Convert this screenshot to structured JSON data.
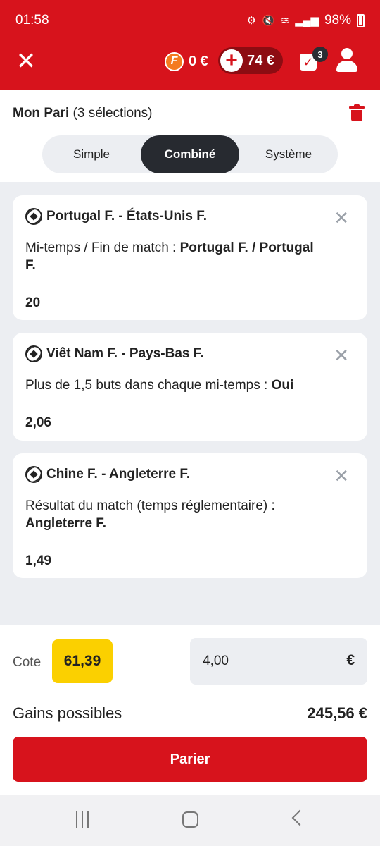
{
  "status_bar": {
    "time": "01:58",
    "battery": "98%"
  },
  "header": {
    "freebet_amount": "0 €",
    "balance": "74 €",
    "betslip_count": "3"
  },
  "bet": {
    "title_bold": "Mon Pari",
    "title_count": "(3 sélections)",
    "tabs": [
      {
        "label": "Simple"
      },
      {
        "label": "Combiné",
        "active": true
      },
      {
        "label": "Système"
      }
    ]
  },
  "selections": [
    {
      "match": "Portugal F. - États-Unis F.",
      "market": "Mi-temps / Fin de match : ",
      "pick": "Portugal F. / Portugal F.",
      "odds": "20"
    },
    {
      "match": "Viêt Nam F. - Pays-Bas F.",
      "market": "Plus de 1,5 buts dans chaque mi-temps : ",
      "pick": "Oui",
      "odds": "2,06"
    },
    {
      "match": "Chine F. - Angleterre F.",
      "market": "Résultat du match (temps réglementaire) : ",
      "pick": "Angleterre F.",
      "odds": "1,49"
    }
  ],
  "summary": {
    "cote_label": "Cote",
    "cote_value": "61,39",
    "stake_value": "4,00",
    "currency": "€",
    "gains_label": "Gains possibles",
    "gains_value": "245,56 €",
    "submit_label": "Parier"
  },
  "colors": {
    "brand_red": "#d7131c",
    "odds_yellow": "#fbd000",
    "dark_tab": "#272a30"
  }
}
